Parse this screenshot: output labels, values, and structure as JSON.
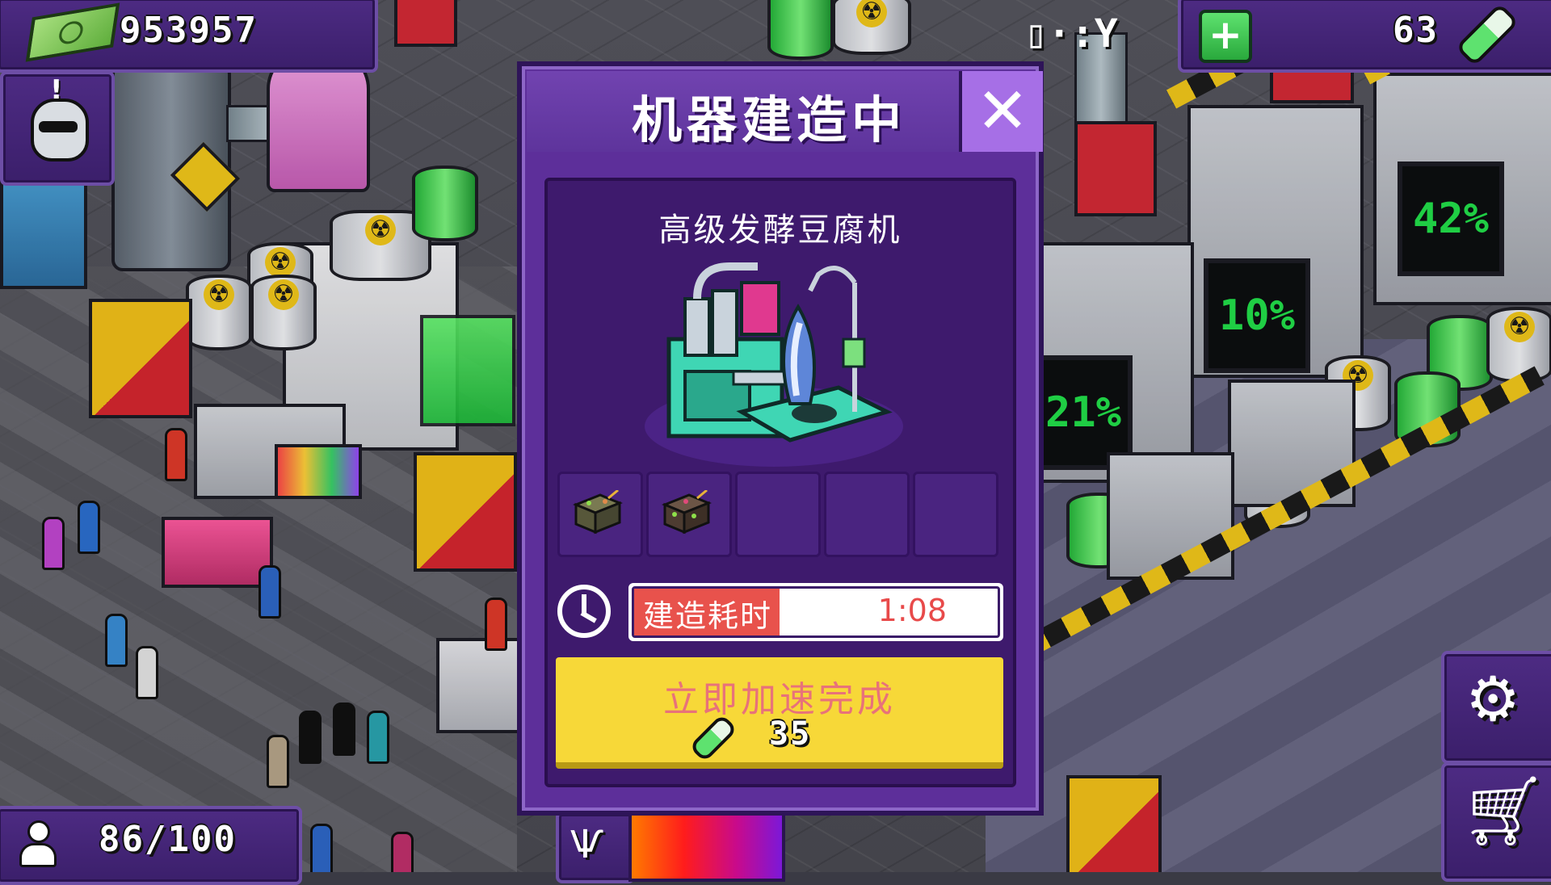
{
  "hud": {
    "money": "953957",
    "energy": "63",
    "population": "86/100",
    "signal_text": "▯·:Y"
  },
  "dialog": {
    "title": "机器建造中",
    "machine_name": "高级发酵豆腐机",
    "build_time_label": "建造耗时",
    "build_time_value": "1:08",
    "build_progress_fraction": 0.4,
    "speedup_label": "立即加速完成",
    "speedup_cost": "35",
    "slots": [
      {
        "filled": true,
        "item_icon": "tofu-cube-icon"
      },
      {
        "filled": true,
        "item_icon": "moldy-tofu-cube-icon"
      },
      {
        "filled": false
      },
      {
        "filled": false
      },
      {
        "filled": false
      }
    ]
  },
  "icons": {
    "money": "cash-stack-icon",
    "alert": "alert-person-icon",
    "signal": "signal-icon",
    "add_energy": "plus-icon",
    "energy": "battery-icon",
    "population": "person-icon",
    "monster": "monster-icon",
    "settings": "gear-icon",
    "shop": "cart-icon",
    "close": "close-icon",
    "clock": "clock-icon"
  },
  "colors": {
    "dialog_bg": "#5d2f9a",
    "panel_bg": "#3e1a6d",
    "progress_fill": "#e8524c",
    "speedup_button": "#f7d838",
    "speedup_text": "#e8727a",
    "close_button": "#a66fe6"
  }
}
